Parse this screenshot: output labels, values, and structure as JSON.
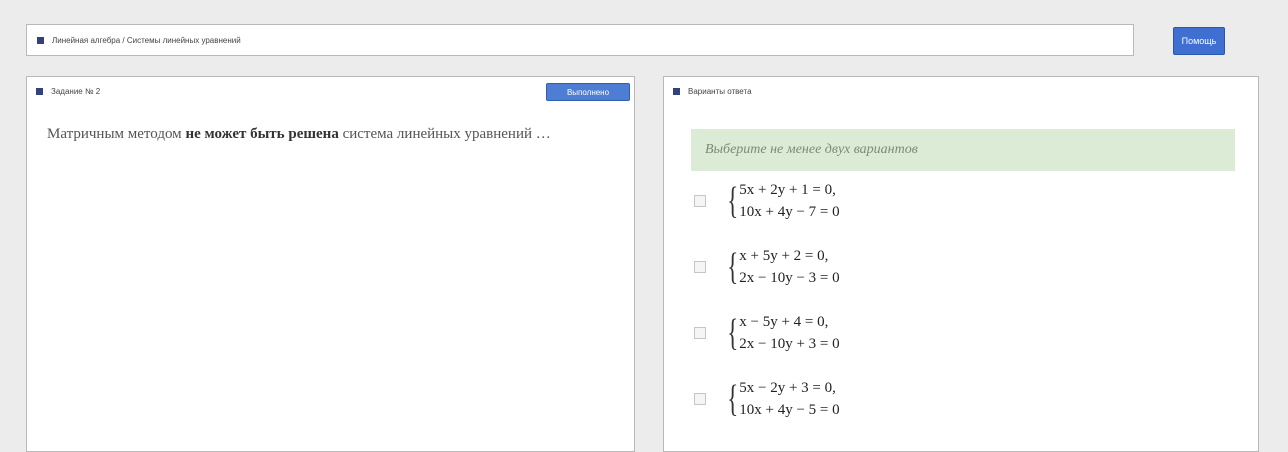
{
  "breadcrumb": {
    "text": "Линейная алгебра / Системы линейных уравнений"
  },
  "help_button": {
    "label": "Помощь"
  },
  "task_panel": {
    "title": "Задание № 2",
    "execute_button": "Выполнено",
    "question_before": "Матричным методом ",
    "question_bold": "не может быть решена",
    "question_after": " система линейных уравнений …"
  },
  "answers_panel": {
    "title": "Варианты ответа",
    "hint": "Выберите не менее двух вариантов",
    "options": [
      {
        "line1": "5x + 2y + 1 = 0,",
        "line2": "10x + 4y − 7 = 0",
        "checked": false
      },
      {
        "line1": "x + 5y + 2 = 0,",
        "line2": "2x − 10y − 3 = 0",
        "checked": false
      },
      {
        "line1": "x − 5y + 4 = 0,",
        "line2": "2x − 10y + 3 = 0",
        "checked": false
      },
      {
        "line1": "5x − 2y + 3 = 0,",
        "line2": "10x + 4y − 5 = 0",
        "checked": false
      }
    ]
  },
  "colors": {
    "accent": "#3f6fd0",
    "header_square": "#31437a",
    "hint_bg": "#dcebd6"
  }
}
